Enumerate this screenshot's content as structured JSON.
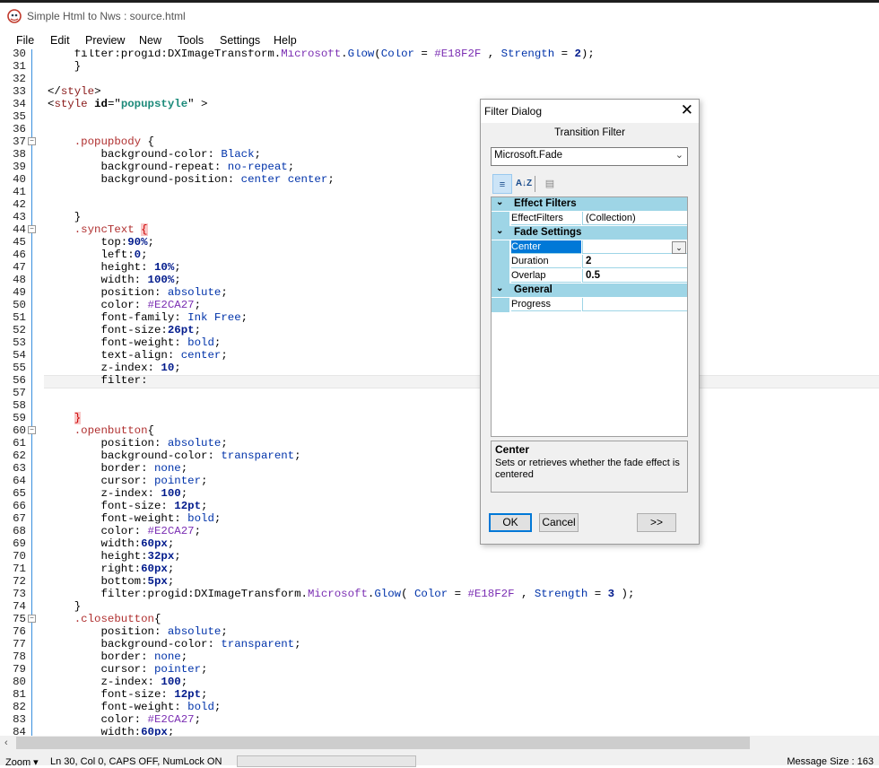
{
  "window": {
    "title": "Simple Html to Nws : source.html"
  },
  "menu": [
    "File",
    "Edit",
    "Preview",
    "New",
    "Tools",
    "Settings",
    "Help"
  ],
  "status": {
    "zoom": "Zoom",
    "position": "Ln 30, Col 0",
    "caps": "CAPS OFF",
    "numlock": "NumLock ON",
    "message": "Message Size : 163"
  },
  "dialog": {
    "title": "Filter Dialog",
    "heading": "Transition Filter",
    "selected_filter": "Microsoft.Fade",
    "toolbar": {
      "categorized": "categorized-icon",
      "alphabetical": "alphabetical-icon",
      "property_pages": "property-pages-icon"
    },
    "grid": {
      "categories": [
        {
          "label": "Effect Filters",
          "rows": [
            {
              "name": "EffectFilters",
              "value": "(Collection)"
            }
          ]
        },
        {
          "label": "Fade Settings",
          "rows": [
            {
              "name": "Center",
              "value": ""
            },
            {
              "name": "Duration",
              "value": "2"
            },
            {
              "name": "Overlap",
              "value": "0.5"
            }
          ]
        },
        {
          "label": "General",
          "rows": [
            {
              "name": "Progress",
              "value": ""
            }
          ]
        }
      ]
    },
    "description": {
      "title": "Center",
      "text": "Sets or retrieves whether the fade effect is centered"
    },
    "buttons": {
      "ok": "OK",
      "cancel": "Cancel",
      "more": ">>"
    }
  },
  "editor": {
    "lines": [
      {
        "n": "30",
        "t": "        filter:progid:DXImageTransform.Microsoft.Glow(Color = #E18F2F , Strength = 2);"
      },
      {
        "n": "31",
        "t": "        }"
      },
      {
        "n": "32",
        "t": ""
      },
      {
        "n": "33",
        "t": "    </style>"
      },
      {
        "n": "34",
        "t": "    <style id=\"popupstyle\" >"
      },
      {
        "n": "35",
        "t": ""
      },
      {
        "n": "36",
        "t": ""
      },
      {
        "n": "37",
        "t": "        .popupbody {"
      },
      {
        "n": "38",
        "t": "            background-color:Black;"
      },
      {
        "n": "39",
        "t": "            background-repeat: no-repeat;"
      },
      {
        "n": "40",
        "t": "            background-position: center center;"
      },
      {
        "n": "41",
        "t": ""
      },
      {
        "n": "42",
        "t": ""
      },
      {
        "n": "43",
        "t": "        }"
      },
      {
        "n": "44",
        "t": "        .syncText {"
      },
      {
        "n": "45",
        "t": "            top:90%;"
      },
      {
        "n": "46",
        "t": "            left:0;"
      },
      {
        "n": "47",
        "t": "            height: 10%;"
      },
      {
        "n": "48",
        "t": "            width: 100%;"
      },
      {
        "n": "49",
        "t": "            position: absolute;"
      },
      {
        "n": "50",
        "t": "            color: #E2CA27;"
      },
      {
        "n": "51",
        "t": "            font-family: Ink Free;"
      },
      {
        "n": "52",
        "t": "            font-size:26pt;"
      },
      {
        "n": "53",
        "t": "            font-weight: bold;"
      },
      {
        "n": "54",
        "t": "            text-align: center;"
      },
      {
        "n": "55",
        "t": "            z-index: 10;"
      },
      {
        "n": "56",
        "t": "            filter:"
      },
      {
        "n": "57",
        "t": ""
      },
      {
        "n": "58",
        "t": ""
      },
      {
        "n": "59",
        "t": "        }"
      },
      {
        "n": "60",
        "t": "        .openbutton{"
      },
      {
        "n": "61",
        "t": "            position: absolute;"
      },
      {
        "n": "62",
        "t": "            background-color:transparent;"
      },
      {
        "n": "63",
        "t": "            border: none;"
      },
      {
        "n": "64",
        "t": "            cursor: pointer;"
      },
      {
        "n": "65",
        "t": "            z-index: 100;"
      },
      {
        "n": "66",
        "t": "            font-size: 12pt;"
      },
      {
        "n": "67",
        "t": "            font-weight: bold;"
      },
      {
        "n": "68",
        "t": "            color: #E2CA27;"
      },
      {
        "n": "69",
        "t": "            width:60px;"
      },
      {
        "n": "70",
        "t": "            height:32px;"
      },
      {
        "n": "71",
        "t": "            right:60px;"
      },
      {
        "n": "72",
        "t": "            bottom:5px;"
      },
      {
        "n": "73",
        "t": "            filter:progid:DXImageTransform.Microsoft.Glow( Color = #E18F2F , Strength = 3 );"
      },
      {
        "n": "74",
        "t": "        }"
      },
      {
        "n": "75",
        "t": "        .closebutton{"
      },
      {
        "n": "76",
        "t": "            position: absolute;"
      },
      {
        "n": "77",
        "t": "            background-color:transparent;"
      },
      {
        "n": "78",
        "t": "            border: none;"
      },
      {
        "n": "79",
        "t": "            cursor: pointer;"
      },
      {
        "n": "80",
        "t": "            z-index: 100;"
      },
      {
        "n": "81",
        "t": "            font-size: 12pt;"
      },
      {
        "n": "82",
        "t": "            font-weight: bold;"
      },
      {
        "n": "83",
        "t": "            color: #E2CA27;"
      },
      {
        "n": "84",
        "t": "            width:60px;"
      }
    ]
  }
}
